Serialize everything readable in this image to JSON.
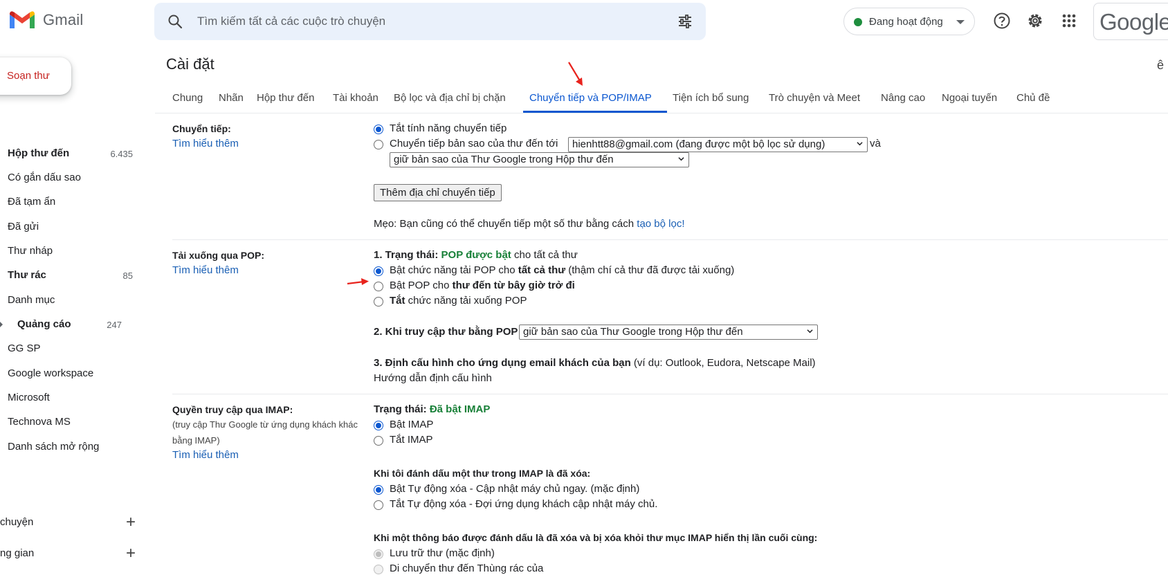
{
  "header": {
    "app_name": "Gmail",
    "search_placeholder": "Tìm kiếm tất cả các cuộc trò chuyện",
    "status_label": "Đang hoạt động",
    "google_logo": "Google",
    "icons": [
      "gmail-logo-icon",
      "search-icon",
      "tune-icon",
      "help-icon",
      "settings-icon",
      "apps-icon"
    ]
  },
  "sidebar": {
    "compose": "Soạn thư",
    "items": [
      {
        "label": "Hộp thư đến",
        "count": "6.435",
        "bold": true
      },
      {
        "label": "Có gắn dấu sao",
        "count": ""
      },
      {
        "label": "Đã tạm ẩn",
        "count": ""
      },
      {
        "label": "Đã gửi",
        "count": ""
      },
      {
        "label": "Thư nháp",
        "count": ""
      },
      {
        "label": "Thư rác",
        "count": "85",
        "bold": true
      },
      {
        "label": "Danh mục",
        "count": ""
      },
      {
        "label": "Quảng cáo",
        "count": "247",
        "bold": true
      },
      {
        "label": "GG SP",
        "count": ""
      },
      {
        "label": "Google workspace",
        "count": ""
      },
      {
        "label": "Microsoft",
        "count": ""
      },
      {
        "label": "Technova MS",
        "count": ""
      },
      {
        "label": "Danh sách mở rộng",
        "count": ""
      }
    ],
    "sections": [
      "chuyện",
      "ng gian"
    ]
  },
  "settings": {
    "title": "Cài đặt",
    "edge_char": "ê",
    "tabs": [
      "Chung",
      "Nhãn",
      "Hộp thư đến",
      "Tài khoản",
      "Bộ lọc và địa chỉ bị chặn",
      "Chuyển tiếp và POP/IMAP",
      "Tiện ích bổ sung",
      "Trò chuyện và Meet",
      "Nâng cao",
      "Ngoại tuyến",
      "Chủ đề"
    ],
    "active_tab": "Chuyển tiếp và POP/IMAP",
    "learn_more": "Tìm hiểu thêm",
    "forwarding": {
      "title": "Chuyển tiếp:",
      "opt_off": "Tắt tính năng chuyển tiếp",
      "opt_fwd_prefix": "Chuyển tiếp bản sao của thư đến tới",
      "fwd_address": "hienhtt88@gmail.com (đang được một bộ lọc sử dụng)",
      "and": "và",
      "keep_copy": "giữ bản sao của Thư Google trong Hộp thư đến",
      "add_button": "Thêm địa chỉ chuyển tiếp",
      "tip_prefix": "Mẹo: Bạn cũng có thể chuyển tiếp một số thư bằng cách",
      "tip_link": "tạo bộ lọc!"
    },
    "pop": {
      "title": "Tải xuống qua POP:",
      "status_prefix": "1. Trạng thái:",
      "status_value": "POP được bật",
      "status_suffix": "cho tất cả thư",
      "opt1_prefix": "Bật chức năng tải POP cho",
      "opt1_bold": "tất cả thư",
      "opt1_suffix": "(thậm chí cả thư đã được tải xuống)",
      "opt2_prefix": "Bật POP cho",
      "opt2_bold": "thư đến từ bây giờ trở đi",
      "opt3_bold": "Tắt",
      "opt3_suffix": "chức năng tải xuống POP",
      "access_label": "2. Khi truy cập thư bằng POP",
      "access_value": "giữ bản sao của Thư Google trong Hộp thư đến",
      "config_label": "3. Định cấu hình cho ứng dụng email khách của bạn",
      "config_suffix": "(ví dụ: Outlook, Eudora, Netscape Mail)",
      "config_link": "Hướng dẫn định cấu hình"
    },
    "imap": {
      "title": "Quyền truy cập qua IMAP:",
      "note": "(truy cập Thư Google từ ứng dụng khách khác bằng IMAP)",
      "status_prefix": "Trạng thái:",
      "status_value": "Đã bật IMAP",
      "opt_on": "Bật IMAP",
      "opt_off": "Tắt IMAP",
      "deleted_heading": "Khi tôi đánh dấu một thư trong IMAP là đã xóa:",
      "auto_on": "Bật Tự động xóa - Cập nhật máy chủ ngay. (mặc định)",
      "auto_off": "Tắt Tự động xóa - Đợi ứng dụng khách cập nhật máy chủ.",
      "expunge_heading": "Khi một thông báo được đánh dấu là đã xóa và bị xóa khỏi thư mục IMAP hiển thị lần cuối cùng:",
      "archive": "Lưu trữ thư (mặc định)",
      "trash": "Di chuyển thư đến Thùng rác của"
    }
  },
  "colors": {
    "accent": "#0b57d0",
    "link": "#1a5fb4",
    "green": "#188038",
    "annotation": "#e8231d"
  }
}
